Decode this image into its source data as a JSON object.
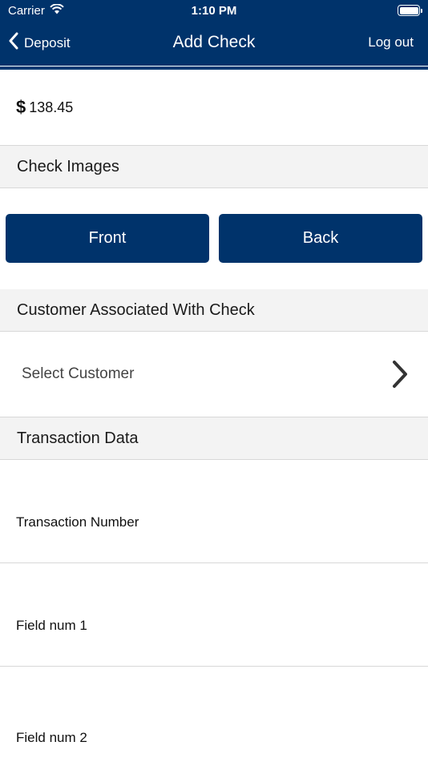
{
  "status_bar": {
    "carrier": "Carrier",
    "time": "1:10 PM"
  },
  "nav": {
    "back_label": "Deposit",
    "title": "Add Check",
    "logout_label": "Log out"
  },
  "amount": {
    "currency_symbol": "$",
    "value": "138.45"
  },
  "sections": {
    "check_images": "Check Images",
    "customer": "Customer Associated With Check",
    "transaction": "Transaction Data"
  },
  "buttons": {
    "front": "Front",
    "back": "Back"
  },
  "customer": {
    "placeholder": "Select Customer"
  },
  "fields": [
    {
      "label": "Transaction Number"
    },
    {
      "label": "Field num 1"
    },
    {
      "label": "Field num 2"
    }
  ],
  "colors": {
    "primary": "#00336b",
    "section_bg": "#f3f3f3",
    "divider": "#d8d8d8"
  }
}
